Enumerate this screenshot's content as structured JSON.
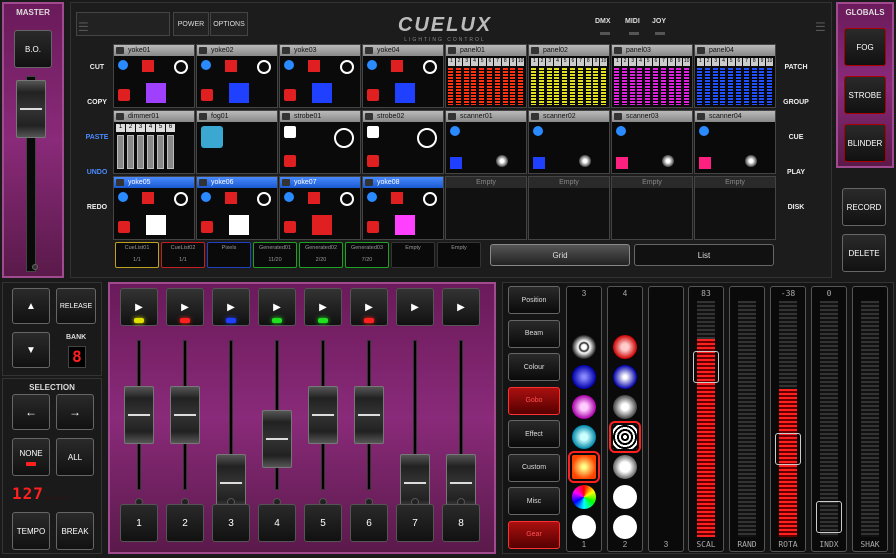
{
  "master": {
    "title": "MASTER",
    "bo_label": "B.O."
  },
  "globals": {
    "title": "GLOBALS",
    "buttons": [
      "FOG",
      "STROBE",
      "BLINDER"
    ]
  },
  "topbar": {
    "power": "POWER",
    "options": "OPTIONS",
    "logo": "CUELUX",
    "logo_sub": "LIGHTING CONTROL",
    "indicators": [
      "DMX",
      "MIDI",
      "JOY"
    ]
  },
  "left_actions": [
    "CUT",
    "COPY",
    "PASTE",
    "UNDO",
    "REDO"
  ],
  "right_actions": [
    "PATCH",
    "GROUP",
    "CUE",
    "PLAY",
    "DISK"
  ],
  "right_buttons": [
    "RECORD",
    "DELETE"
  ],
  "fixtures_row1": [
    "yoke01",
    "yoke02",
    "yoke03",
    "yoke04",
    "panel01",
    "panel02",
    "panel03",
    "panel04"
  ],
  "fixtures_row2": [
    "dimmer01",
    "fog01",
    "strobe01",
    "strobe02",
    "scanner01",
    "scanner02",
    "scanner03",
    "scanner04"
  ],
  "fixtures_row3": [
    "yoke05",
    "yoke06",
    "yoke07",
    "yoke08",
    "Empty",
    "Empty",
    "Empty",
    "Empty"
  ],
  "panel_digits": [
    "1",
    "2",
    "3",
    "4",
    "5",
    "6",
    "7",
    "8",
    "9",
    "10"
  ],
  "dimmer_digits": [
    "1",
    "2",
    "3",
    "4",
    "5",
    "6"
  ],
  "cues": [
    {
      "name": "CueList01",
      "val": "1/1"
    },
    {
      "name": "CueList02",
      "val": "1/1"
    },
    {
      "name": "Pixels",
      "val": ""
    },
    {
      "name": "Generated01",
      "val": "11/20"
    },
    {
      "name": "Generated02",
      "val": "2/20"
    },
    {
      "name": "Generated03",
      "val": "7/20"
    },
    {
      "name": "Empty",
      "val": ""
    },
    {
      "name": "Empty",
      "val": ""
    }
  ],
  "view_tabs": [
    "Grid",
    "List"
  ],
  "playback": {
    "release": "RELEASE",
    "bank_label": "BANK",
    "bank_value": "8",
    "up": "▲",
    "down": "▼",
    "channels": [
      "1",
      "2",
      "3",
      "4",
      "5",
      "6",
      "7",
      "8"
    ],
    "play_icon": "▶",
    "led_colors": [
      "#e0e000",
      "#ff2020",
      "#2040ff",
      "#20e020",
      "#20e020",
      "#ff2020",
      "",
      ""
    ],
    "fader_levels": [
      0.62,
      0.62,
      0.05,
      0.42,
      0.62,
      0.62,
      0.05,
      0.05
    ]
  },
  "selection": {
    "title": "SELECTION",
    "left": "←",
    "right": "→",
    "none": "NONE",
    "all": "ALL",
    "counter": "127",
    "tempo": "TEMPO",
    "break": "BREAK"
  },
  "attributes": [
    "Position",
    "Beam",
    "Colour",
    "Gobo",
    "Effect",
    "Custom",
    "Misc",
    "Gear"
  ],
  "active_attributes": [
    "Gobo",
    "Gear"
  ],
  "gobo_cols": [
    {
      "top": "3",
      "bot": "1"
    },
    {
      "top": "4",
      "bot": "2"
    },
    {
      "top": "",
      "bot": "3"
    }
  ],
  "meters": [
    {
      "top": "83",
      "bot": "SCAL",
      "level": 0.83,
      "sel": 0.75
    },
    {
      "top": "",
      "bot": "RAND",
      "level": 0,
      "sel": -1
    },
    {
      "top": "-38",
      "bot": "ROTA",
      "level": 0.62,
      "sel": 0.35
    },
    {
      "top": "0",
      "bot": "INDX",
      "level": 0,
      "sel": 0.02
    },
    {
      "top": "",
      "bot": "SHAK",
      "level": 0,
      "sel": -1
    }
  ],
  "colors": {
    "accent": "#4a8aff",
    "purple": "#8a2a7a",
    "red": "#ff2020"
  }
}
